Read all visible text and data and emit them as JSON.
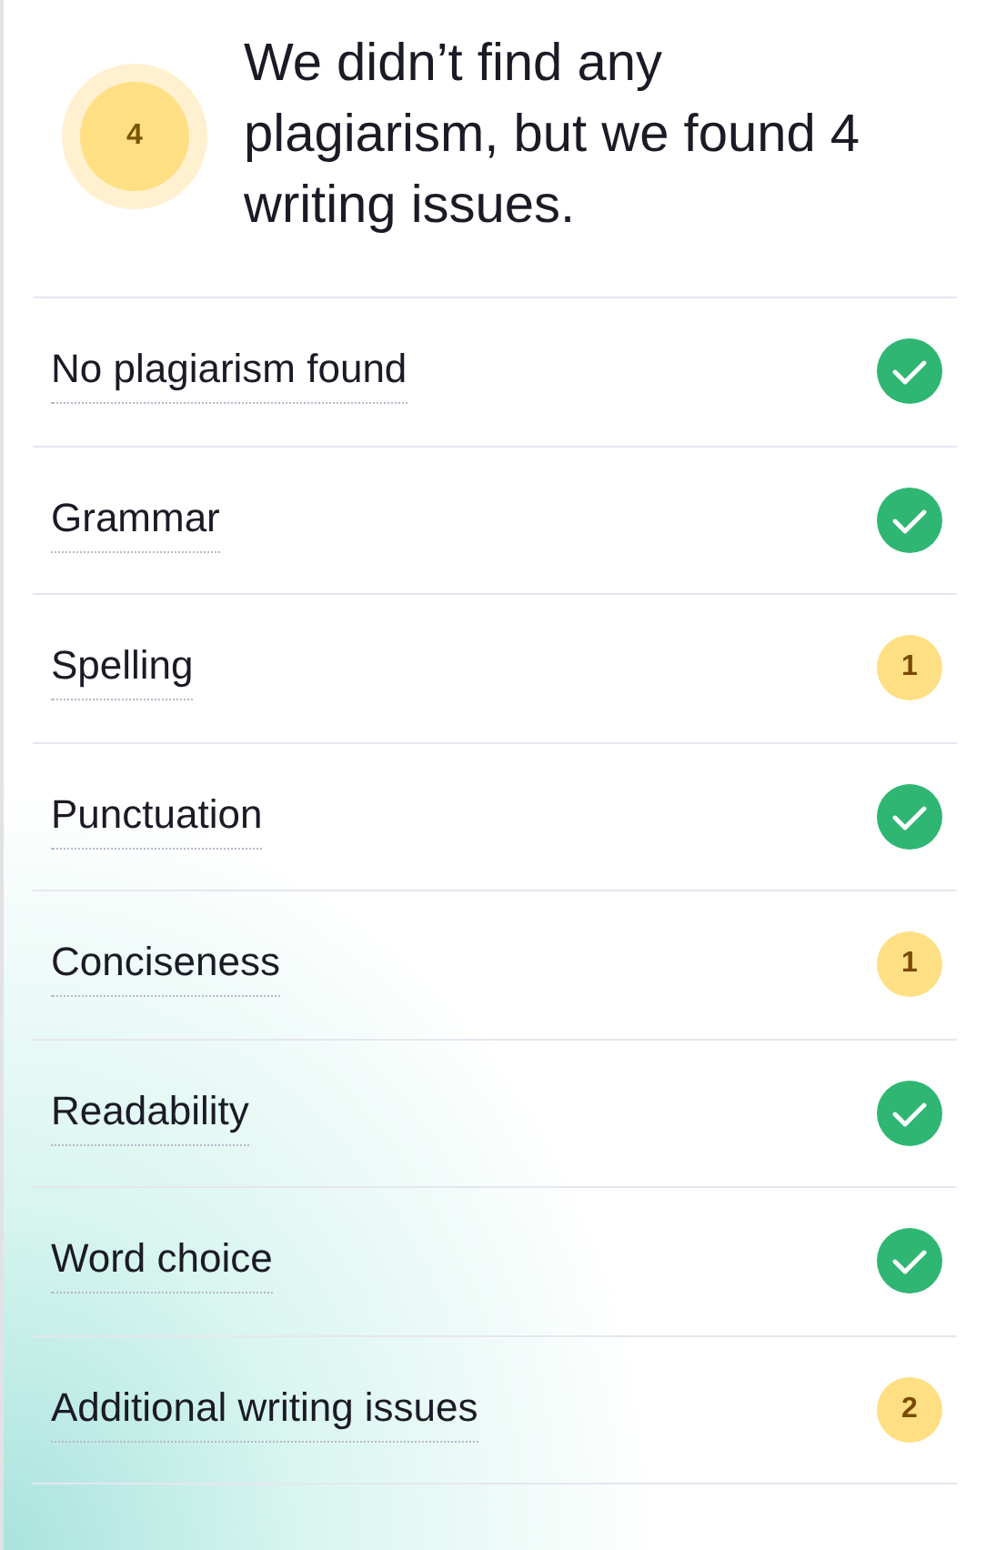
{
  "summary": {
    "count": "4",
    "text": "We didn’t find any plagiarism, but we found 4 writing issues."
  },
  "checks": [
    {
      "label": "No plagiarism found",
      "kind": "check"
    },
    {
      "label": "Grammar",
      "kind": "check"
    },
    {
      "label": "Spelling",
      "kind": "count",
      "count": "1"
    },
    {
      "label": "Punctuation",
      "kind": "check"
    },
    {
      "label": "Conciseness",
      "kind": "count",
      "count": "1"
    },
    {
      "label": "Readability",
      "kind": "check"
    },
    {
      "label": "Word choice",
      "kind": "check"
    },
    {
      "label": "Additional writing issues",
      "kind": "count",
      "count": "2"
    }
  ]
}
